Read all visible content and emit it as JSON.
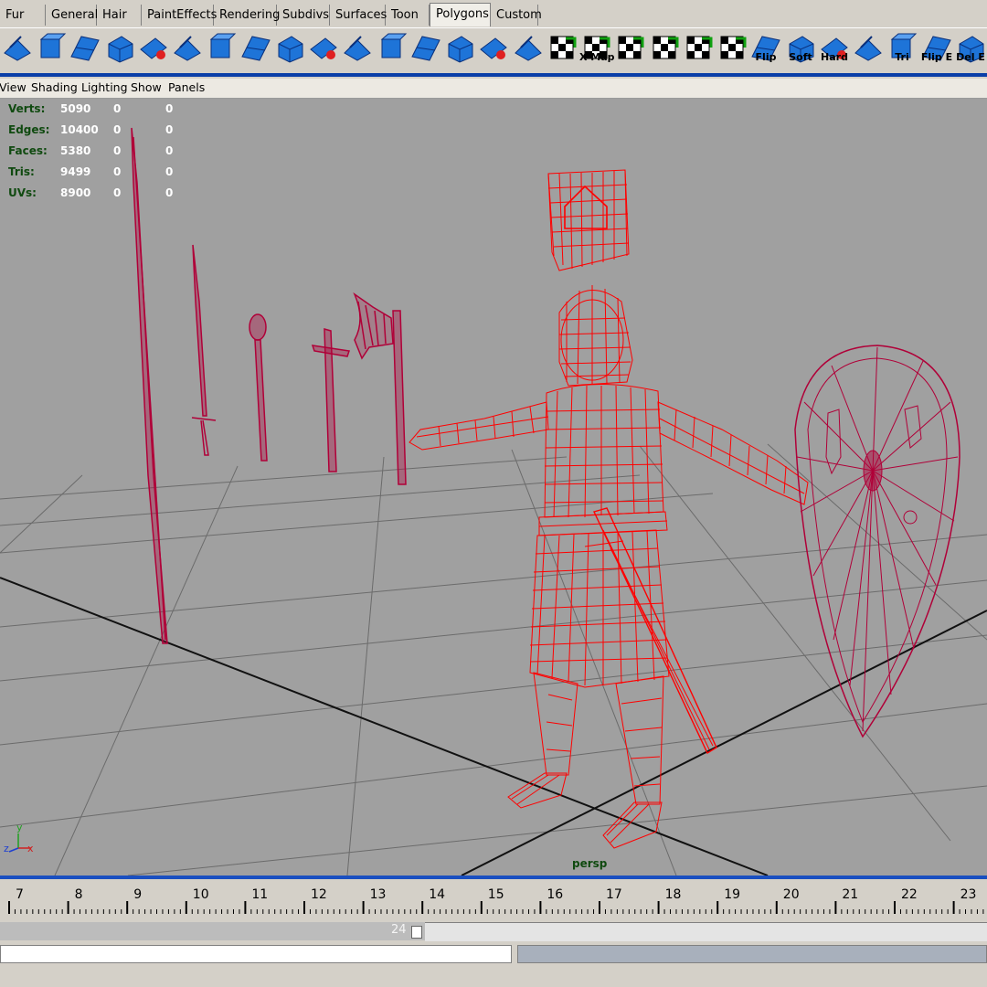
{
  "shelf_tabs": [
    {
      "label": "Fur",
      "active": false
    },
    {
      "label": "General",
      "active": false
    },
    {
      "label": "Hair",
      "active": false
    },
    {
      "label": "PaintEffects",
      "active": false
    },
    {
      "label": "Rendering",
      "active": false
    },
    {
      "label": "Subdivs",
      "active": false
    },
    {
      "label": "Surfaces",
      "active": false
    },
    {
      "label": "Toon",
      "active": false
    },
    {
      "label": "Polygons",
      "active": true
    },
    {
      "label": "Custom",
      "active": false
    }
  ],
  "shelf_buttons": [
    {
      "icon": "poly-sphere-icon",
      "caption": ""
    },
    {
      "icon": "poly-cube-icon",
      "caption": ""
    },
    {
      "icon": "poly-plane-icon",
      "caption": ""
    },
    {
      "icon": "split-polygon-icon",
      "caption": ""
    },
    {
      "icon": "extrude-face-icon",
      "caption": ""
    },
    {
      "icon": "extrude-edge-icon",
      "caption": ""
    },
    {
      "icon": "bevel-icon",
      "caption": ""
    },
    {
      "icon": "wedge-face-icon",
      "caption": ""
    },
    {
      "icon": "merge-vertices-icon",
      "caption": ""
    },
    {
      "icon": "append-polygon-icon",
      "caption": ""
    },
    {
      "icon": "cut-faces-icon",
      "caption": ""
    },
    {
      "icon": "collapse-icon",
      "caption": ""
    },
    {
      "icon": "smooth-icon",
      "caption": ""
    },
    {
      "icon": "combine-icon",
      "caption": ""
    },
    {
      "icon": "separate-icon",
      "caption": ""
    },
    {
      "icon": "create-uvs-icon",
      "caption": ""
    },
    {
      "icon": "uv-checker-icon",
      "caption": ""
    },
    {
      "icon": "texture-map-icon",
      "caption": "X Map"
    },
    {
      "icon": "uv-layout-icon",
      "caption": ""
    },
    {
      "icon": "uv-checker-rotate-icon",
      "caption": ""
    },
    {
      "icon": "uv-snapshot-icon",
      "caption": ""
    },
    {
      "icon": "uv-editor-icon",
      "caption": ""
    },
    {
      "icon": "flip-normals-icon",
      "caption": "Flip"
    },
    {
      "icon": "soften-edge-icon",
      "caption": "Soft"
    },
    {
      "icon": "harden-edge-icon",
      "caption": "Hard"
    },
    {
      "icon": "reverse-icon",
      "caption": ""
    },
    {
      "icon": "triangulate-icon",
      "caption": "Tri"
    },
    {
      "icon": "flip-edge-icon",
      "caption": "Flip E"
    },
    {
      "icon": "delete-edge-icon",
      "caption": "Del E"
    }
  ],
  "panel_menu": [
    "View",
    "Shading",
    "Lighting",
    "Show",
    "Panels"
  ],
  "hud": [
    {
      "label": "Verts:",
      "total": "5090",
      "selected": "0",
      "other": "0"
    },
    {
      "label": "Edges:",
      "total": "10400",
      "selected": "0",
      "other": "0"
    },
    {
      "label": "Faces:",
      "total": "5380",
      "selected": "0",
      "other": "0"
    },
    {
      "label": "Tris:",
      "total": "9499",
      "selected": "0",
      "other": "0"
    },
    {
      "label": "UVs:",
      "total": "8900",
      "selected": "0",
      "other": "0"
    }
  ],
  "camera_label": "persp",
  "axis_labels": {
    "x": "x",
    "y": "y",
    "z": "z"
  },
  "timeline": {
    "frames": [
      "7",
      "8",
      "9",
      "10",
      "11",
      "12",
      "13",
      "14",
      "15",
      "16",
      "17",
      "18",
      "19",
      "20",
      "21",
      "22",
      "23"
    ]
  },
  "range_slider": {
    "end_value": "24"
  },
  "colors": {
    "wireframe_selected": "#ff0000",
    "wireframe_props": "#b00038",
    "viewport_bg": "#a0a0a0",
    "grid_line": "#4a4a4a",
    "hud_label": "#104a10",
    "accent_blue": "#0a3ea8"
  }
}
